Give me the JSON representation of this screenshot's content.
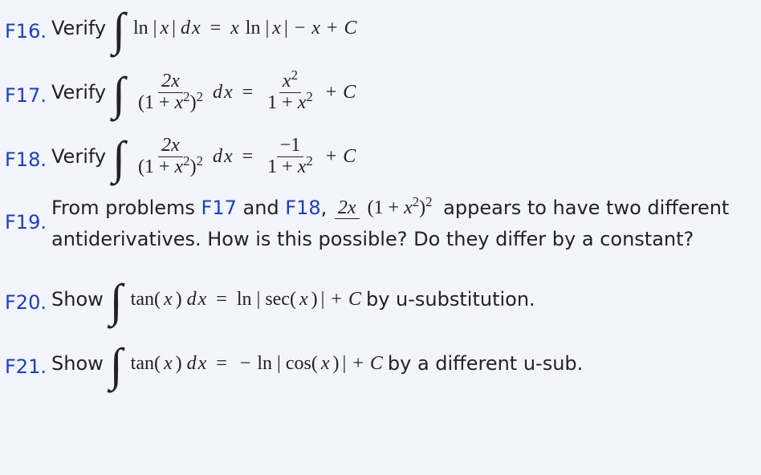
{
  "problems": {
    "f16": {
      "num": "F16.",
      "verb": "Verify",
      "integrand": "ln |x|",
      "dx": "dx",
      "eq": "=",
      "rhs_a": "x ln |x|",
      "rhs_b": "− x + C"
    },
    "f17": {
      "num": "F17.",
      "verb": "Verify",
      "frac_num": "2x",
      "frac_den": "(1 + x²)²",
      "dx": "dx",
      "eq": "=",
      "rhs_num": "x²",
      "rhs_den": "1 + x²",
      "tail": "+ C"
    },
    "f18": {
      "num": "F18.",
      "verb": "Verify",
      "frac_num": "2x",
      "frac_den": "(1 + x²)²",
      "dx": "dx",
      "eq": "=",
      "rhs_num": "−1",
      "rhs_den": "1 + x²",
      "tail": "+ C"
    },
    "f19": {
      "num": "F19.",
      "lead": "From problems ",
      "ref1": "F17",
      "and": " and ",
      "ref2": "F18",
      "comma": ", ",
      "frac_num": "2x",
      "frac_den": "(1 + x²)²",
      "after_frac": " appears to have two different",
      "line2": "antiderivatives.  How is this possible?  Do they differ by a constant?"
    },
    "f20": {
      "num": "F20.",
      "verb": "Show",
      "integrand": "tan(x)",
      "dx": "dx",
      "eq": "=",
      "rhs": "ln | sec(x)| + C",
      "tail": " by u-substitution."
    },
    "f21": {
      "num": "F21.",
      "verb": "Show",
      "integrand": "tan(x)",
      "dx": "dx",
      "eq": "=",
      "rhs": "− ln | cos(x)| + C",
      "tail": " by a different u-sub."
    }
  }
}
